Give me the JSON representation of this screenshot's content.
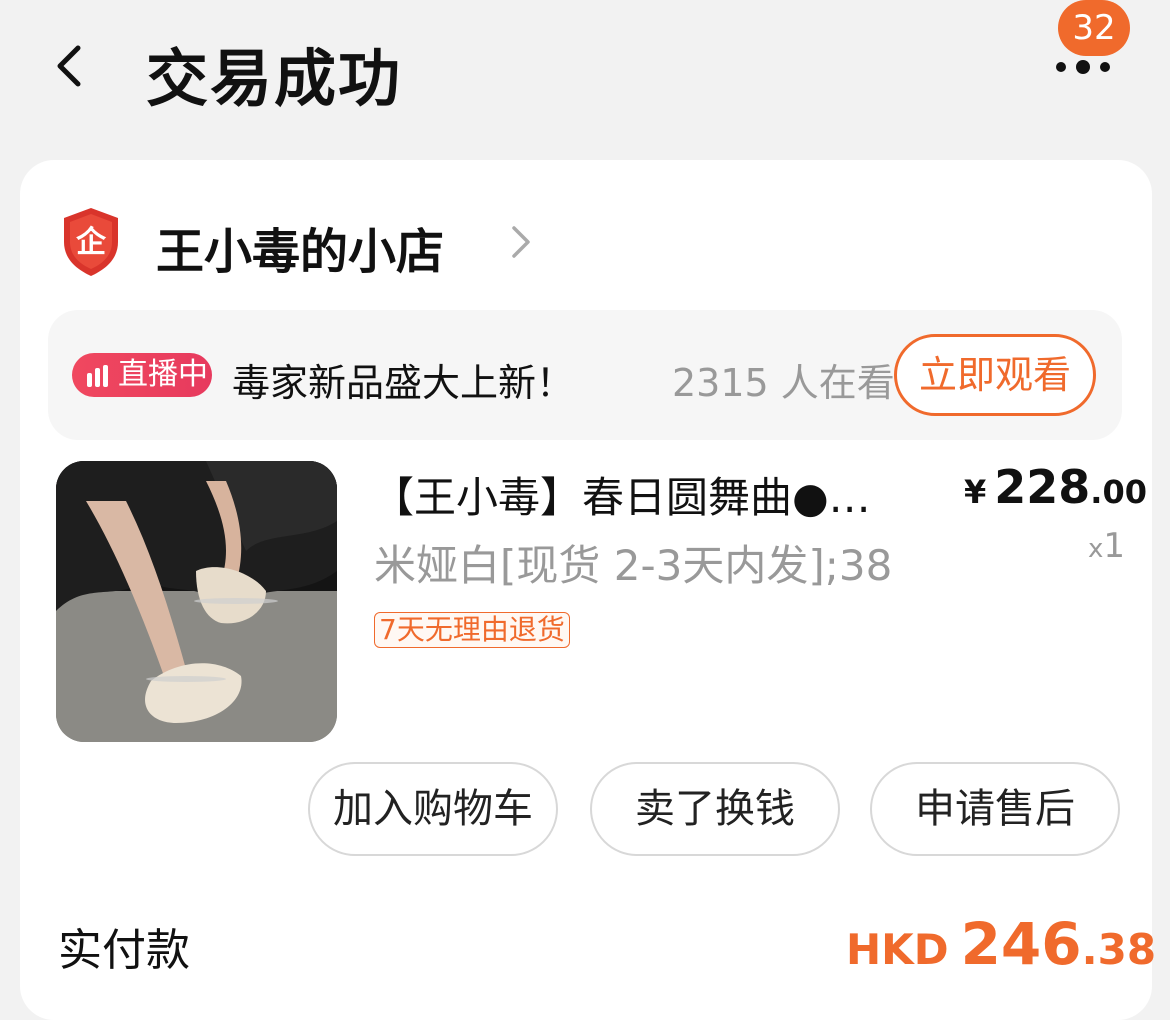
{
  "header": {
    "title": "交易成功",
    "badge_count": "32"
  },
  "shop": {
    "name": "王小毒的小店",
    "logo_glyph": "企"
  },
  "live": {
    "tag_label": "直播中",
    "text": "毒家新品盛大上新！",
    "viewers": "2315 人在看",
    "watch_label": "立即观看"
  },
  "product": {
    "title": "【王小毒】春日圆舞曲●…",
    "price_symbol": "¥",
    "price_int": "228",
    "price_dec": ".00",
    "sku": "米娅白[现货 2-3天内发];38",
    "qty_x": "x",
    "qty_n": "1",
    "return_policy": "7天无理由退货"
  },
  "actions": {
    "cart": "加入购物车",
    "resell": "卖了换钱",
    "aftersale": "申请售后"
  },
  "payment": {
    "label": "实付款",
    "currency": "HKD",
    "amount_int": "246",
    "amount_dec": ".38"
  },
  "colors": {
    "accent": "#f06a2c",
    "live_red": "#e73a5e",
    "background": "#f2f2f2"
  },
  "icons": [
    "back-arrow-icon",
    "more-dots-icon",
    "shop-shield-icon",
    "chevron-right-icon",
    "live-bars-icon"
  ]
}
